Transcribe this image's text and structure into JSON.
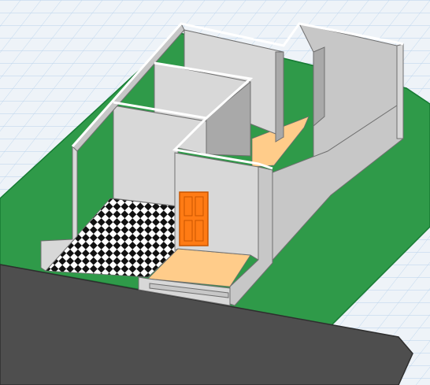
{
  "viewport": {
    "view_mode": "3D",
    "background_color": "#eef3f8",
    "grid_line_color": "#b9d3ec"
  },
  "colors": {
    "lawn": "#2f9a49",
    "lawn_edge": "#167a33",
    "road": "#4e4e4e",
    "road_edge": "#2e2e2e",
    "wall_face_light": "#d8d8d8",
    "wall_face_mid": "#c7c7c7",
    "wall_face_dark": "#a9a9a9",
    "wall_top": "#ffffff",
    "wall_outline": "#6f6f6f",
    "wood_floor": "#ffcc8a",
    "tile_dark": "#111111",
    "tile_light": "#ffffff",
    "door": "#ff7b14",
    "door_outline": "#c85500"
  },
  "model": {
    "objects": [
      {
        "id": "lawn",
        "kind": "ground",
        "material": "grass"
      },
      {
        "id": "road",
        "kind": "ground",
        "material": "asphalt"
      },
      {
        "id": "house-walls",
        "kind": "walls",
        "material": "white-plaster"
      },
      {
        "id": "entrance-tile-floor",
        "kind": "floor",
        "material": "checkerboard-tile"
      },
      {
        "id": "porch-floor",
        "kind": "floor",
        "material": "wood"
      },
      {
        "id": "corridor-floor",
        "kind": "floor",
        "material": "wood"
      },
      {
        "id": "front-door",
        "kind": "door",
        "material": "orange-panel"
      }
    ]
  }
}
